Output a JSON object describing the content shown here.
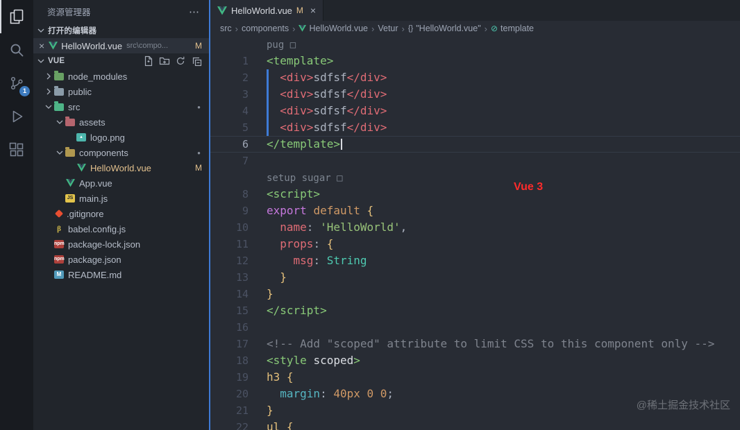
{
  "activity_bar": {
    "items": [
      {
        "name": "explorer",
        "active": true
      },
      {
        "name": "search",
        "active": false
      },
      {
        "name": "source-control",
        "active": false,
        "badge": "1"
      },
      {
        "name": "run-and-debug",
        "active": false
      },
      {
        "name": "extensions",
        "active": false
      }
    ]
  },
  "sidebar": {
    "title": "资源管理器",
    "more_label": "⋯",
    "open_editors": {
      "section_label": "打开的编辑器",
      "items": [
        {
          "close_label": "×",
          "file": "HelloWorld.vue",
          "detail": "src\\compo...",
          "badge": "M"
        }
      ]
    },
    "project": {
      "section_label": "VUE",
      "actions": [
        "new-file",
        "new-folder",
        "refresh-explorer",
        "collapse-folders"
      ],
      "tree": [
        {
          "label": "node_modules",
          "icon": "folder-node",
          "level": 0,
          "twistie": "collapsed"
        },
        {
          "label": "public",
          "icon": "folder-public",
          "level": 0,
          "twistie": "collapsed"
        },
        {
          "label": "src",
          "icon": "folder-src",
          "level": 0,
          "twistie": "expanded",
          "dot": true
        },
        {
          "label": "assets",
          "icon": "folder-assets",
          "level": 1,
          "twistie": "expanded"
        },
        {
          "label": "logo.png",
          "icon": "image",
          "level": 2,
          "twistie": "none"
        },
        {
          "label": "components",
          "icon": "folder-components",
          "level": 1,
          "twistie": "expanded",
          "dot": true
        },
        {
          "label": "HelloWorld.vue",
          "icon": "vue",
          "level": 2,
          "twistie": "none",
          "badge": "M",
          "modified": true
        },
        {
          "label": "App.vue",
          "icon": "vue",
          "level": 1,
          "twistie": "none"
        },
        {
          "label": "main.js",
          "icon": "js",
          "level": 1,
          "twistie": "none"
        },
        {
          "label": ".gitignore",
          "icon": "git",
          "level": 0,
          "twistie": "none"
        },
        {
          "label": "babel.config.js",
          "icon": "babel",
          "level": 0,
          "twistie": "none"
        },
        {
          "label": "package-lock.json",
          "icon": "npm",
          "level": 0,
          "twistie": "none"
        },
        {
          "label": "package.json",
          "icon": "npm",
          "level": 0,
          "twistie": "none"
        },
        {
          "label": "README.md",
          "icon": "md",
          "level": 0,
          "twistie": "none"
        }
      ]
    }
  },
  "editor": {
    "tabs": [
      {
        "label": "HelloWorld.vue",
        "badge": "M",
        "close_label": "×",
        "icon": "vue"
      }
    ],
    "breadcrumbs": [
      {
        "label": "src"
      },
      {
        "label": "components"
      },
      {
        "label": "HelloWorld.vue",
        "icon": "vue"
      },
      {
        "label": "Vetur"
      },
      {
        "label": "\"HelloWorld.vue\"",
        "icon": "braces"
      },
      {
        "label": "template",
        "icon": "symbol"
      }
    ],
    "palette": {
      "plain": "#abb2bf",
      "tagGreen": "#89ca78",
      "tagRed": "#e06c75",
      "keyword": "#c678dd",
      "keyword2": "#d19a66",
      "property": "#e06c75",
      "string": "#98c379",
      "type": "#4ec9b0",
      "brace": "#e5c07b",
      "comment": "#7f848e",
      "attr": "#dcdfe4",
      "selector": "#e5c07b",
      "cssProp": "#56b6c2",
      "number": "#d19a66"
    },
    "code": {
      "rows": [
        {
          "type": "lens",
          "text": "pug □"
        },
        {
          "type": "code",
          "num": "1",
          "tokens": [
            [
              "<template>",
              "tagGreen"
            ]
          ]
        },
        {
          "type": "code",
          "num": "2",
          "guide": true,
          "tokens": [
            [
              "  ",
              "plain"
            ],
            [
              "<div>",
              "tagRed"
            ],
            [
              "sdfsf",
              "plain"
            ],
            [
              "</div>",
              "tagRed"
            ]
          ]
        },
        {
          "type": "code",
          "num": "3",
          "guide": true,
          "tokens": [
            [
              "  ",
              "plain"
            ],
            [
              "<div>",
              "tagRed"
            ],
            [
              "sdfsf",
              "plain"
            ],
            [
              "</div>",
              "tagRed"
            ]
          ]
        },
        {
          "type": "code",
          "num": "4",
          "guide": true,
          "tokens": [
            [
              "  ",
              "plain"
            ],
            [
              "<div>",
              "tagRed"
            ],
            [
              "sdfsf",
              "plain"
            ],
            [
              "</div>",
              "tagRed"
            ]
          ]
        },
        {
          "type": "code",
          "num": "5",
          "guide": true,
          "tokens": [
            [
              "  ",
              "plain"
            ],
            [
              "<div>",
              "tagRed"
            ],
            [
              "sdfsf",
              "plain"
            ],
            [
              "</div>",
              "tagRed"
            ]
          ]
        },
        {
          "type": "code",
          "num": "6",
          "current": true,
          "caret": true,
          "tokens": [
            [
              "</template>",
              "tagGreen"
            ]
          ]
        },
        {
          "type": "code",
          "num": "7",
          "tokens": []
        },
        {
          "type": "lens",
          "text": "setup sugar □"
        },
        {
          "type": "code",
          "num": "8",
          "tokens": [
            [
              "<script>",
              "tagGreen"
            ]
          ]
        },
        {
          "type": "code",
          "num": "9",
          "tokens": [
            [
              "export",
              "keyword"
            ],
            [
              " ",
              "plain"
            ],
            [
              "default",
              "keyword2"
            ],
            [
              " ",
              "plain"
            ],
            [
              "{",
              "brace"
            ]
          ]
        },
        {
          "type": "code",
          "num": "10",
          "tokens": [
            [
              "  ",
              "plain"
            ],
            [
              "name",
              "property"
            ],
            [
              ": ",
              "plain"
            ],
            [
              "'HelloWorld'",
              "string"
            ],
            [
              ",",
              "plain"
            ]
          ]
        },
        {
          "type": "code",
          "num": "11",
          "tokens": [
            [
              "  ",
              "plain"
            ],
            [
              "props",
              "property"
            ],
            [
              ": ",
              "plain"
            ],
            [
              "{",
              "brace"
            ]
          ]
        },
        {
          "type": "code",
          "num": "12",
          "tokens": [
            [
              "    ",
              "plain"
            ],
            [
              "msg",
              "property"
            ],
            [
              ": ",
              "plain"
            ],
            [
              "String",
              "type"
            ]
          ]
        },
        {
          "type": "code",
          "num": "13",
          "tokens": [
            [
              "  ",
              "plain"
            ],
            [
              "}",
              "brace"
            ]
          ]
        },
        {
          "type": "code",
          "num": "14",
          "tokens": [
            [
              "}",
              "brace"
            ]
          ]
        },
        {
          "type": "code",
          "num": "15",
          "tokens": [
            [
              "</script>",
              "tagGreen"
            ]
          ]
        },
        {
          "type": "code",
          "num": "16",
          "tokens": []
        },
        {
          "type": "code",
          "num": "17",
          "tokens": [
            [
              "<!-- Add \"scoped\" attribute to limit CSS to this component only -->",
              "comment"
            ]
          ]
        },
        {
          "type": "code",
          "num": "18",
          "tokens": [
            [
              "<style ",
              "tagGreen"
            ],
            [
              "scoped",
              "attr"
            ],
            [
              ">",
              "tagGreen"
            ]
          ]
        },
        {
          "type": "code",
          "num": "19",
          "tokens": [
            [
              "h3",
              "selector"
            ],
            [
              " ",
              "plain"
            ],
            [
              "{",
              "brace"
            ]
          ]
        },
        {
          "type": "code",
          "num": "20",
          "tokens": [
            [
              "  ",
              "plain"
            ],
            [
              "margin",
              "cssProp"
            ],
            [
              ": ",
              "plain"
            ],
            [
              "40px 0 0",
              "number"
            ],
            [
              ";",
              "plain"
            ]
          ]
        },
        {
          "type": "code",
          "num": "21",
          "tokens": [
            [
              "}",
              "brace"
            ]
          ]
        },
        {
          "type": "code",
          "num": "22",
          "tokens": [
            [
              "ul",
              "selector"
            ],
            [
              " ",
              "plain"
            ],
            [
              "{",
              "brace"
            ]
          ]
        }
      ]
    },
    "annotation": {
      "text": "Vue 3",
      "color": "#ff2b2b"
    },
    "watermark": "@稀土掘金技术社区"
  }
}
